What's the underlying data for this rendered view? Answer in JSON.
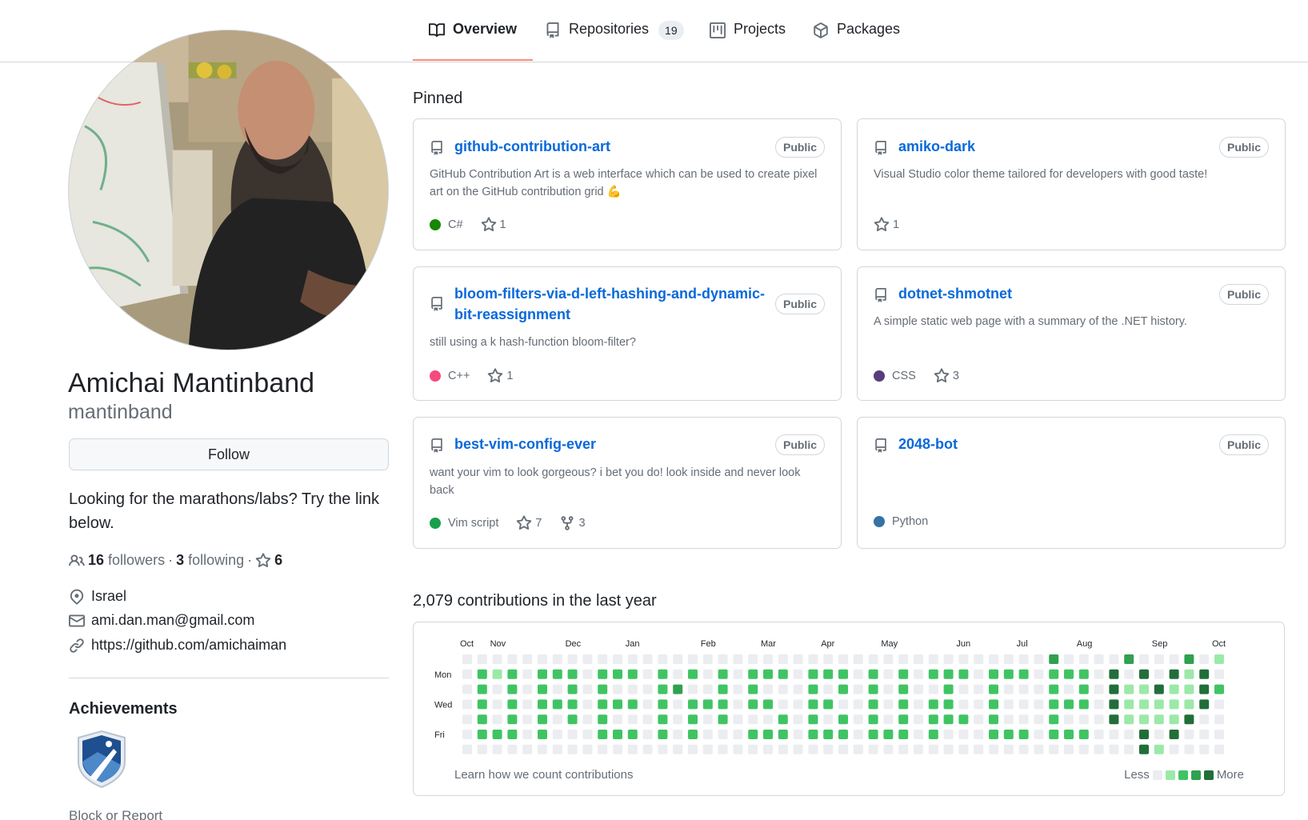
{
  "nav": {
    "tabs": [
      {
        "label": "Overview",
        "icon": "book-icon"
      },
      {
        "label": "Repositories",
        "icon": "repo-icon",
        "count": "19"
      },
      {
        "label": "Projects",
        "icon": "project-board-icon"
      },
      {
        "label": "Packages",
        "icon": "package-icon"
      }
    ]
  },
  "profile": {
    "full_name": "Amichai Mantinband",
    "login": "mantinband",
    "follow_label": "Follow",
    "bio": "Looking for the marathons/labs? Try the link below.",
    "followers_count": "16",
    "followers_label": "followers",
    "following_count": "3",
    "following_label": "following",
    "stars_count": "6",
    "location": "Israel",
    "email": "ami.dan.man@gmail.com",
    "website": "https://github.com/amichaiman",
    "achievements_title": "Achievements",
    "block_report": "Block or Report"
  },
  "pinned": {
    "title": "Pinned",
    "repos": [
      {
        "name": "github-contribution-art",
        "visibility": "Public",
        "description": "GitHub Contribution Art is a web interface which can be used to create pixel art on the GitHub contribution grid 💪",
        "language": "C#",
        "language_color": "#178600",
        "stars": "1"
      },
      {
        "name": "amiko-dark",
        "visibility": "Public",
        "description": "Visual Studio color theme tailored for developers with good taste!",
        "stars": "1"
      },
      {
        "name": "bloom-filters-via-d-left-hashing-and-dynamic-bit-reassignment",
        "visibility": "Public",
        "description": "still using a k hash-function bloom-filter?",
        "language": "C++",
        "language_color": "#f34b7d",
        "stars": "1"
      },
      {
        "name": "dotnet-shmotnet",
        "visibility": "Public",
        "description": "A simple static web page with a summary of the .NET history.",
        "language": "CSS",
        "language_color": "#563d7c",
        "stars": "3"
      },
      {
        "name": "best-vim-config-ever",
        "visibility": "Public",
        "description": "want your vim to look gorgeous? i bet you do! look inside and never look back",
        "language": "Vim script",
        "language_color": "#199f4b",
        "stars": "7",
        "forks": "3"
      },
      {
        "name": "2048-bot",
        "visibility": "Public",
        "language": "Python",
        "language_color": "#3572A5"
      }
    ]
  },
  "contributions": {
    "title": "2,079 contributions in the last year",
    "months": [
      "Oct",
      "Nov",
      "Dec",
      "Jan",
      "Feb",
      "Mar",
      "Apr",
      "May",
      "Jun",
      "Jul",
      "Aug",
      "Sep",
      "Oct"
    ],
    "day_labels": [
      "Mon",
      "Wed",
      "Fri"
    ],
    "learn_label": "Learn how we count contributions",
    "legend_less": "Less",
    "legend_more": "More",
    "level_colors": [
      "#ebedf0",
      "#9be9a8",
      "#40c463",
      "#30a14e",
      "#216e39"
    ],
    "weeks": [
      [
        0,
        0,
        0,
        0,
        0,
        0,
        0
      ],
      [
        0,
        2,
        2,
        2,
        2,
        2,
        0
      ],
      [
        0,
        1,
        0,
        0,
        0,
        2,
        0
      ],
      [
        0,
        2,
        2,
        2,
        2,
        2,
        0
      ],
      [
        0,
        0,
        0,
        0,
        0,
        0,
        0
      ],
      [
        0,
        2,
        2,
        2,
        2,
        2,
        0
      ],
      [
        0,
        2,
        0,
        2,
        0,
        0,
        0
      ],
      [
        0,
        2,
        2,
        2,
        2,
        0,
        0
      ],
      [
        0,
        0,
        0,
        0,
        0,
        0,
        0
      ],
      [
        0,
        2,
        2,
        2,
        2,
        2,
        0
      ],
      [
        0,
        2,
        0,
        2,
        0,
        2,
        0
      ],
      [
        0,
        2,
        0,
        2,
        0,
        2,
        0
      ],
      [
        0,
        0,
        0,
        0,
        0,
        0,
        0
      ],
      [
        0,
        2,
        2,
        2,
        2,
        2,
        0
      ],
      [
        0,
        0,
        3,
        0,
        0,
        0,
        0
      ],
      [
        0,
        2,
        0,
        2,
        2,
        2,
        0
      ],
      [
        0,
        0,
        0,
        2,
        0,
        0,
        0
      ],
      [
        0,
        2,
        2,
        2,
        2,
        0,
        0
      ],
      [
        0,
        0,
        0,
        0,
        0,
        0,
        0
      ],
      [
        0,
        2,
        2,
        2,
        0,
        2,
        0
      ],
      [
        0,
        2,
        0,
        2,
        0,
        2,
        0
      ],
      [
        0,
        2,
        0,
        0,
        2,
        2,
        0
      ],
      [
        0,
        0,
        0,
        0,
        0,
        0,
        0
      ],
      [
        0,
        2,
        2,
        2,
        2,
        2,
        0
      ],
      [
        0,
        2,
        0,
        2,
        0,
        2,
        0
      ],
      [
        0,
        2,
        2,
        0,
        2,
        2,
        0
      ],
      [
        0,
        0,
        0,
        0,
        0,
        0,
        0
      ],
      [
        0,
        2,
        2,
        2,
        2,
        2,
        0
      ],
      [
        0,
        0,
        0,
        0,
        0,
        2,
        0
      ],
      [
        0,
        2,
        2,
        2,
        2,
        2,
        0
      ],
      [
        0,
        0,
        0,
        0,
        0,
        0,
        0
      ],
      [
        0,
        2,
        0,
        2,
        2,
        2,
        0
      ],
      [
        0,
        2,
        2,
        2,
        2,
        0,
        0
      ],
      [
        0,
        2,
        0,
        0,
        2,
        0,
        0
      ],
      [
        0,
        0,
        0,
        0,
        0,
        0,
        0
      ],
      [
        0,
        2,
        2,
        2,
        2,
        2,
        0
      ],
      [
        0,
        2,
        0,
        0,
        0,
        2,
        0
      ],
      [
        0,
        2,
        0,
        0,
        0,
        2,
        0
      ],
      [
        0,
        0,
        0,
        0,
        0,
        0,
        0
      ],
      [
        3,
        2,
        2,
        2,
        2,
        2,
        0
      ],
      [
        0,
        2,
        0,
        2,
        0,
        2,
        0
      ],
      [
        0,
        2,
        2,
        2,
        0,
        2,
        0
      ],
      [
        0,
        0,
        0,
        0,
        0,
        0,
        0
      ],
      [
        0,
        4,
        4,
        4,
        4,
        0,
        0
      ],
      [
        3,
        0,
        1,
        1,
        1,
        0,
        0
      ],
      [
        0,
        4,
        1,
        1,
        1,
        4,
        4
      ],
      [
        0,
        0,
        4,
        1,
        1,
        0,
        1
      ],
      [
        0,
        4,
        1,
        1,
        1,
        4,
        0
      ],
      [
        3,
        1,
        1,
        1,
        4,
        0,
        0
      ],
      [
        0,
        4,
        4,
        4,
        0,
        0,
        0
      ],
      [
        1,
        0,
        2,
        0,
        0,
        0,
        0
      ]
    ]
  }
}
